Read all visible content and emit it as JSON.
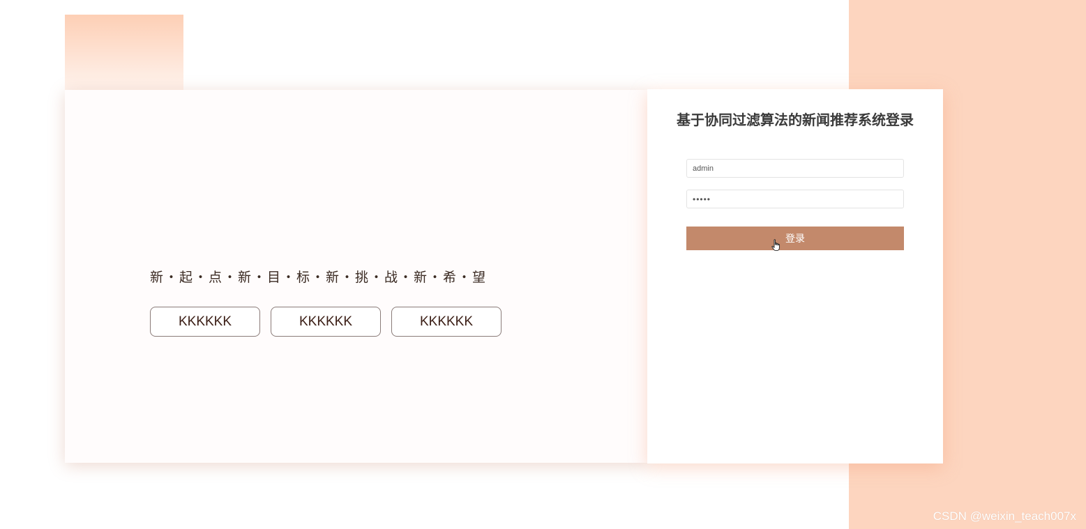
{
  "left_panel": {
    "slogan": "新・起・点・新・目・标・新・挑・战・新・希・望",
    "tags": [
      "KKKKKK",
      "KKKKKK",
      "KKKKKK"
    ]
  },
  "login": {
    "title": "基于协同过滤算法的新闻推荐系统登录",
    "username_value": "admin",
    "password_value": "•••••",
    "submit_label": "登录"
  },
  "watermark": "CSDN @weixin_teach007x",
  "colors": {
    "accent_button": "#c3896b",
    "background_band": "#fdd5bf"
  },
  "icons": {
    "cursor": "hand-pointer-icon"
  }
}
